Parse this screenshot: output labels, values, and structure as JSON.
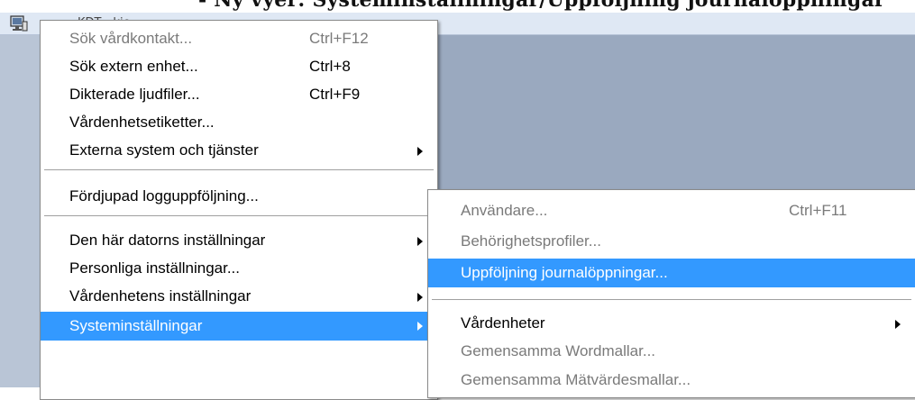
{
  "document": {
    "visible_text": "- Ny vyer: Systeminställningar/Uppföljning journalöppningar"
  },
  "app": {
    "tab_title": "KDT - kje..."
  },
  "main_menu": {
    "items": [
      {
        "label": "Sök vårdkontakt...",
        "shortcut": "Ctrl+F12",
        "state": "disabled"
      },
      {
        "label": "Sök extern enhet...",
        "shortcut": "Ctrl+8",
        "state": "normal"
      },
      {
        "label": "Dikterade ljudfiler...",
        "shortcut": "Ctrl+F9",
        "state": "normal"
      },
      {
        "label": "Vårdenhetsetiketter...",
        "shortcut": "",
        "state": "normal"
      },
      {
        "label": "Externa system och tjänster",
        "shortcut": "",
        "state": "normal",
        "submenu": true
      },
      {
        "label": "Fördjupad logguppföljning...",
        "shortcut": "",
        "state": "normal"
      },
      {
        "label": "Den här datorns inställningar",
        "shortcut": "",
        "state": "normal",
        "submenu": true
      },
      {
        "label": "Personliga inställningar...",
        "shortcut": "",
        "state": "normal"
      },
      {
        "label": "Vårdenhetens inställningar",
        "shortcut": "",
        "state": "normal",
        "submenu": true
      },
      {
        "label": "Systeminställningar",
        "shortcut": "",
        "state": "selected",
        "submenu": true
      }
    ]
  },
  "sub_menu": {
    "items": [
      {
        "label": "Användare...",
        "shortcut": "Ctrl+F11",
        "state": "disabled"
      },
      {
        "label": "Behörighetsprofiler...",
        "shortcut": "",
        "state": "disabled"
      },
      {
        "label": "Uppföljning journalöppningar...",
        "shortcut": "",
        "state": "selected"
      },
      {
        "label": "Vårdenheter",
        "shortcut": "",
        "state": "normal",
        "submenu": true
      },
      {
        "label": "Gemensamma Wordmallar...",
        "shortcut": "",
        "state": "disabled"
      },
      {
        "label": "Gemensamma Mätvärdesmallar...",
        "shortcut": "",
        "state": "disabled"
      }
    ]
  },
  "colors": {
    "selection": "#3399ff",
    "workspace": "#9aa9bf",
    "disabled_text": "#7a7a7a"
  }
}
